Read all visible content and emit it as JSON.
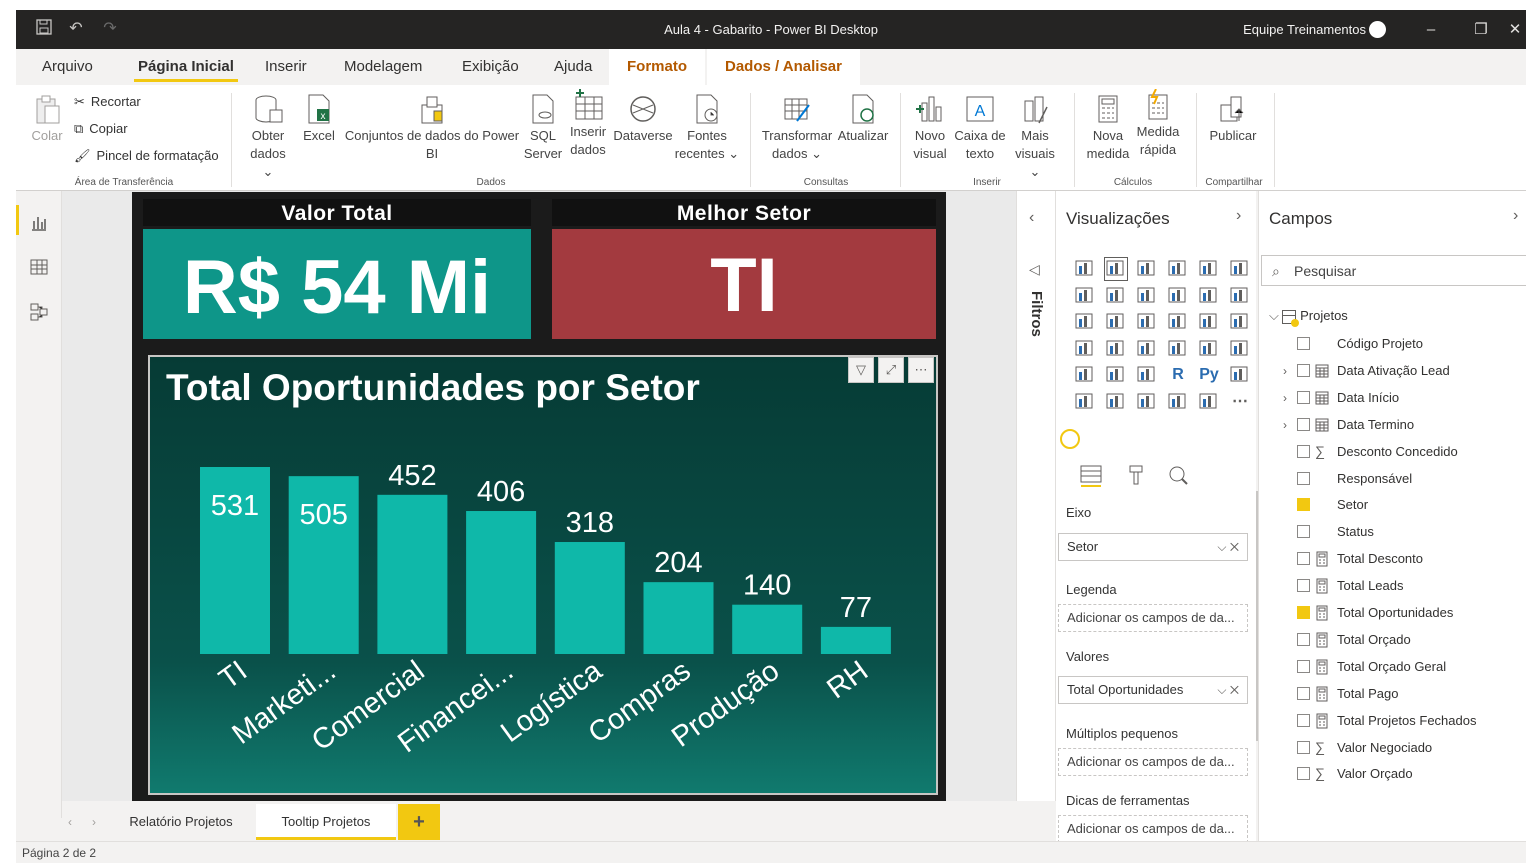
{
  "window": {
    "title": "Aula 4 - Gabarito - Power BI Desktop",
    "user": "Equipe Treinamentos"
  },
  "menu_tabs": [
    "Arquivo",
    "Página Inicial",
    "Inserir",
    "Modelagem",
    "Exibição",
    "Ajuda",
    "Formato",
    "Dados / Analisar"
  ],
  "ribbon": {
    "paste": "Colar",
    "cut": "Recortar",
    "copy": "Copiar",
    "format_painter": "Pincel de formatação",
    "group_clipboard": "Área de Transferência",
    "get_data_1": "Obter",
    "get_data_2": "dados",
    "excel": "Excel",
    "datasets_1": "Conjuntos de dados do Power",
    "datasets_2": "BI",
    "sql_1": "SQL",
    "sql_2": "Server",
    "enter_data_1": "Inserir",
    "enter_data_2": "dados",
    "dataverse": "Dataverse",
    "recent_1": "Fontes",
    "recent_2": "recentes",
    "group_data": "Dados",
    "transform_1": "Transformar",
    "transform_2": "dados",
    "refresh": "Atualizar",
    "group_queries": "Consultas",
    "new_visual_1": "Novo",
    "new_visual_2": "visual",
    "textbox_1": "Caixa de",
    "textbox_2": "texto",
    "more_visuals_1": "Mais",
    "more_visuals_2": "visuais",
    "group_insert": "Inserir",
    "new_measure_1": "Nova",
    "new_measure_2": "medida",
    "quick_measure_1": "Medida",
    "quick_measure_2": "rápida",
    "group_calc": "Cálculos",
    "publish": "Publicar",
    "group_share": "Compartilhar"
  },
  "report": {
    "card1": {
      "title": "Valor Total",
      "value": "R$ 54 Mi",
      "color": "#0e9689"
    },
    "card2": {
      "title": "Melhor Setor",
      "value": "TI",
      "color": "#a33a3f"
    },
    "chart_title": "Total Oportunidades por Setor"
  },
  "chart_data": {
    "type": "bar",
    "title": "Total Oportunidades por Setor",
    "categories": [
      "TI",
      "Marketi...",
      "Comercial",
      "Financei...",
      "Logística",
      "Compras",
      "Produção",
      "RH"
    ],
    "values": [
      531,
      505,
      452,
      406,
      318,
      204,
      140,
      77
    ],
    "bar_color": "#0fb8a9",
    "ylim": [
      0,
      531
    ]
  },
  "filters_label": "Filtros",
  "visualizations": {
    "title": "Visualizações",
    "wells": [
      {
        "label": "Eixo",
        "value": "Setor",
        "filled": true
      },
      {
        "label": "Legenda",
        "value": "Adicionar os campos de da...",
        "filled": false
      },
      {
        "label": "Valores",
        "value": "Total Oportunidades",
        "filled": true
      },
      {
        "label": "Múltiplos pequenos",
        "value": "Adicionar os campos de da...",
        "filled": false
      },
      {
        "label": "Dicas de ferramentas",
        "value": "Adicionar os campos de da...",
        "filled": false
      }
    ]
  },
  "fields": {
    "title": "Campos",
    "search_placeholder": "Pesquisar",
    "table": "Projetos",
    "items": [
      {
        "name": "Código Projeto",
        "type": "none",
        "checked": false,
        "expand": false
      },
      {
        "name": "Data Ativação Lead",
        "type": "date",
        "checked": false,
        "expand": true
      },
      {
        "name": "Data Início",
        "type": "date",
        "checked": false,
        "expand": true
      },
      {
        "name": "Data Termino",
        "type": "date",
        "checked": false,
        "expand": true
      },
      {
        "name": "Desconto Concedido",
        "type": "sum",
        "checked": false,
        "expand": false
      },
      {
        "name": "Responsável",
        "type": "none",
        "checked": false,
        "expand": false
      },
      {
        "name": "Setor",
        "type": "none",
        "checked": true,
        "expand": false
      },
      {
        "name": "Status",
        "type": "none",
        "checked": false,
        "expand": false
      },
      {
        "name": "Total Desconto",
        "type": "measure",
        "checked": false,
        "expand": false
      },
      {
        "name": "Total Leads",
        "type": "measure",
        "checked": false,
        "expand": false
      },
      {
        "name": "Total Oportunidades",
        "type": "measure",
        "checked": true,
        "expand": false
      },
      {
        "name": "Total Orçado",
        "type": "measure",
        "checked": false,
        "expand": false
      },
      {
        "name": "Total Orçado Geral",
        "type": "measure",
        "checked": false,
        "expand": false
      },
      {
        "name": "Total Pago",
        "type": "measure",
        "checked": false,
        "expand": false
      },
      {
        "name": "Total Projetos Fechados",
        "type": "measure",
        "checked": false,
        "expand": false
      },
      {
        "name": "Valor Negociado",
        "type": "sum",
        "checked": false,
        "expand": false
      },
      {
        "name": "Valor Orçado",
        "type": "sum",
        "checked": false,
        "expand": false
      }
    ]
  },
  "page_tabs": [
    "Relatório Projetos",
    "Tooltip Projetos"
  ],
  "add_page": "+",
  "status": "Página 2 de 2"
}
